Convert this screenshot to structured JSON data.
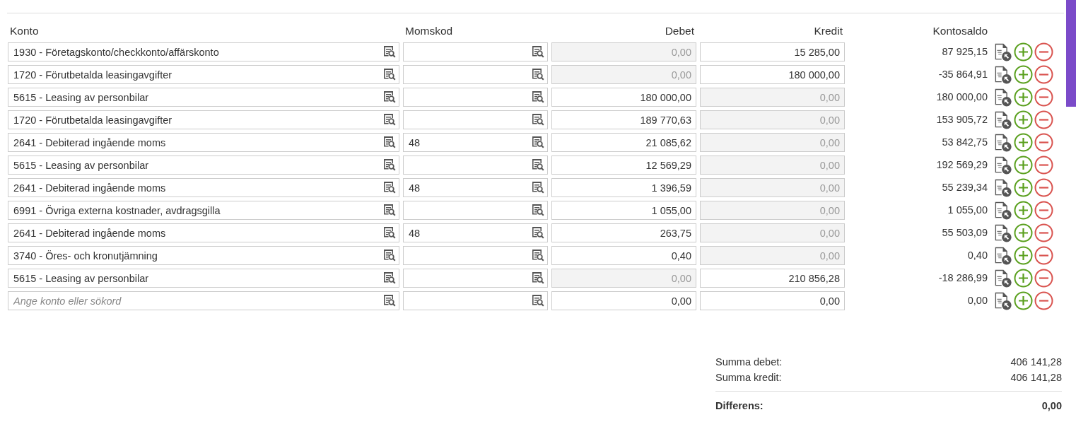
{
  "columns": [
    "Konto",
    "Momskod",
    "Debet",
    "Kredit",
    "Kontosaldo"
  ],
  "rows": [
    {
      "konto": "1930 - Företagskonto/checkkonto/affärskonto",
      "momskod": "",
      "debet": {
        "value": "0,00",
        "disabled": true
      },
      "kredit": {
        "value": "15 285,00",
        "disabled": false
      },
      "saldo": "87 925,15"
    },
    {
      "konto": "1720 - Förutbetalda leasingavgifter",
      "momskod": "",
      "debet": {
        "value": "0,00",
        "disabled": true
      },
      "kredit": {
        "value": "180 000,00",
        "disabled": false
      },
      "saldo": "-35 864,91"
    },
    {
      "konto": "5615 - Leasing av personbilar",
      "momskod": "",
      "debet": {
        "value": "180 000,00",
        "disabled": false
      },
      "kredit": {
        "value": "0,00",
        "disabled": true
      },
      "saldo": "180 000,00"
    },
    {
      "konto": "1720 - Förutbetalda leasingavgifter",
      "momskod": "",
      "debet": {
        "value": "189 770,63",
        "disabled": false
      },
      "kredit": {
        "value": "0,00",
        "disabled": true
      },
      "saldo": "153 905,72"
    },
    {
      "konto": "2641 - Debiterad ingående moms",
      "momskod": "48",
      "debet": {
        "value": "21 085,62",
        "disabled": false
      },
      "kredit": {
        "value": "0,00",
        "disabled": true
      },
      "saldo": "53 842,75"
    },
    {
      "konto": "5615 - Leasing av personbilar",
      "momskod": "",
      "debet": {
        "value": "12 569,29",
        "disabled": false
      },
      "kredit": {
        "value": "0,00",
        "disabled": true
      },
      "saldo": "192 569,29"
    },
    {
      "konto": "2641 - Debiterad ingående moms",
      "momskod": "48",
      "debet": {
        "value": "1 396,59",
        "disabled": false
      },
      "kredit": {
        "value": "0,00",
        "disabled": true
      },
      "saldo": "55 239,34"
    },
    {
      "konto": "6991 - Övriga externa kostnader, avdragsgilla",
      "momskod": "",
      "debet": {
        "value": "1 055,00",
        "disabled": false
      },
      "kredit": {
        "value": "0,00",
        "disabled": true
      },
      "saldo": "1 055,00"
    },
    {
      "konto": "2641 - Debiterad ingående moms",
      "momskod": "48",
      "debet": {
        "value": "263,75",
        "disabled": false
      },
      "kredit": {
        "value": "0,00",
        "disabled": true
      },
      "saldo": "55 503,09"
    },
    {
      "konto": "3740 - Öres- och kronutjämning",
      "momskod": "",
      "debet": {
        "value": "0,40",
        "disabled": false
      },
      "kredit": {
        "value": "0,00",
        "disabled": true
      },
      "saldo": "0,40"
    },
    {
      "konto": "5615 - Leasing av personbilar",
      "momskod": "",
      "debet": {
        "value": "0,00",
        "disabled": true
      },
      "kredit": {
        "value": "210 856,28",
        "disabled": false
      },
      "saldo": "-18 286,99"
    },
    {
      "konto_placeholder": "Ange konto eller sökord",
      "momskod": "",
      "debet": {
        "value": "0,00",
        "disabled": false
      },
      "kredit": {
        "value": "0,00",
        "disabled": false
      },
      "saldo": "0,00"
    }
  ],
  "totals": [
    {
      "label": "Summa debet:",
      "value": "406 141,28"
    },
    {
      "label": "Summa kredit:",
      "value": "406 141,28"
    }
  ],
  "difference": {
    "label": "Differens:",
    "value": "0,00"
  }
}
